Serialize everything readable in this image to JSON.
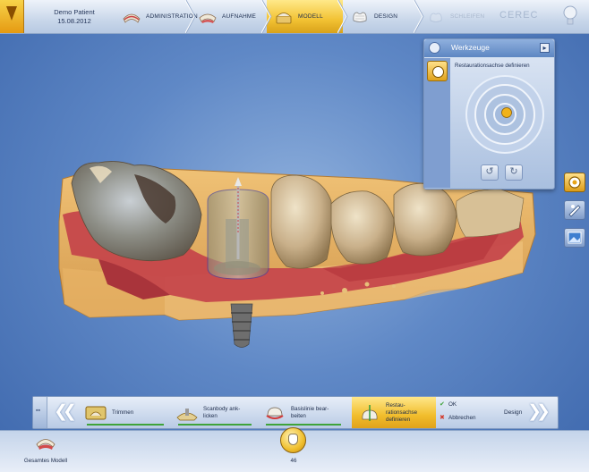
{
  "patient": {
    "name": "Demo Patient",
    "date": "15.08.2012"
  },
  "phases": [
    {
      "label": "ADMINISTRATION",
      "state": "normal"
    },
    {
      "label": "AUFNAHME",
      "state": "normal"
    },
    {
      "label": "MODELL",
      "state": "active"
    },
    {
      "label": "DESIGN",
      "state": "normal"
    },
    {
      "label": "SCHLEIFEN",
      "state": "disabled"
    }
  ],
  "brand": "CEREC",
  "tools_panel": {
    "title": "Werkzeuge",
    "tool_label": "Restaurationsachse definieren"
  },
  "steps": [
    {
      "label_1": "Trimmen",
      "label_2": "",
      "complete": true
    },
    {
      "label_1": "Scanbody ank-",
      "label_2": "licken",
      "complete": true
    },
    {
      "label_1": "Basislinie bear-",
      "label_2": "beiten",
      "complete": true
    },
    {
      "label_1": "Restau-",
      "label_2": "rationsachse",
      "label_3": "definieren",
      "active": true
    }
  ],
  "actions": {
    "ok": "OK",
    "cancel": "Abbrechen"
  },
  "next_phase": "Design",
  "footer": {
    "model_label": "Gesamtes Modell",
    "tooth_number": "46"
  },
  "colors": {
    "accent": "#f2c233",
    "background": "#5f88c6",
    "ok_green": "#3fa33a",
    "cancel_red": "#d33a2a"
  }
}
